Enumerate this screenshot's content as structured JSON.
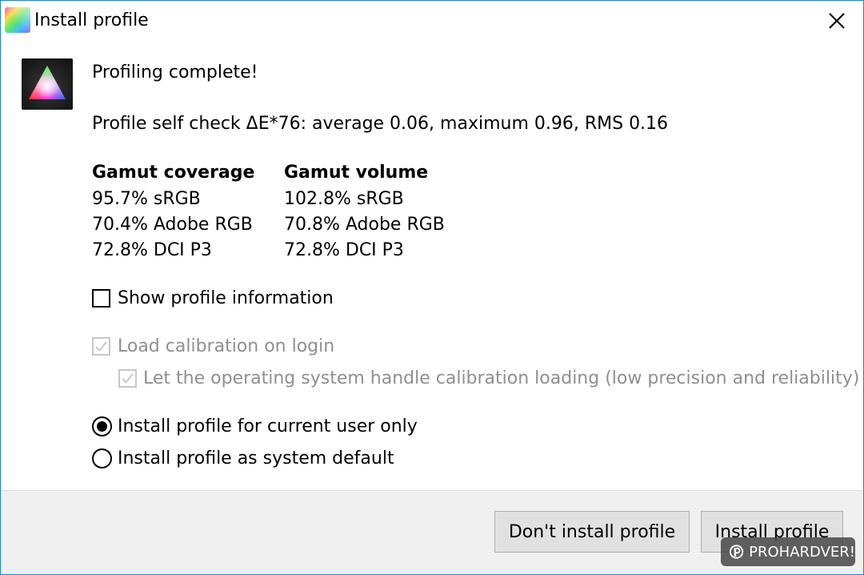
{
  "window": {
    "title": "Install profile"
  },
  "message": {
    "heading": "Profiling complete!",
    "self_check": "Profile self check ΔE*76: average 0.06, maximum 0.96, RMS 0.16"
  },
  "gamut": {
    "coverage": {
      "header": "Gamut coverage",
      "rows": [
        "95.7% sRGB",
        "70.4% Adobe RGB",
        "72.8% DCI P3"
      ]
    },
    "volume": {
      "header": "Gamut volume",
      "rows": [
        "102.8% sRGB",
        "70.8% Adobe RGB",
        "72.8% DCI P3"
      ]
    }
  },
  "options": {
    "show_info": {
      "label": "Show profile information",
      "checked": false
    },
    "load_calibration": {
      "label": "Load calibration on login",
      "checked": true,
      "enabled": false
    },
    "os_handle": {
      "label": "Let the operating system handle calibration loading (low precision and reliability)",
      "checked": true,
      "enabled": false
    }
  },
  "install_scope": {
    "current_user": {
      "label": "Install profile for current user only",
      "selected": true
    },
    "system_default": {
      "label": "Install profile as system default",
      "selected": false
    }
  },
  "buttons": {
    "dont_install": "Don't install profile",
    "install": "Install profile"
  },
  "watermark": {
    "text": "PROHARDVER!"
  },
  "icons": {
    "app": "app-icon",
    "profile": "profile-triangle-icon",
    "close": "close-icon",
    "check": "check-icon"
  },
  "colors": {
    "window_border": "#1883d7",
    "footer_bg": "#f0f0f0",
    "button_bg": "#e1e1e1",
    "disabled_text": "#8f8f8f"
  }
}
